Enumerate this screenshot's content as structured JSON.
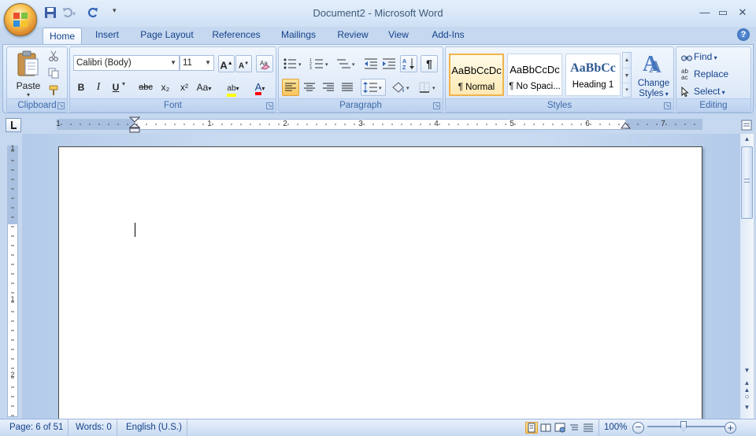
{
  "window": {
    "title": "Document2 - Microsoft Word"
  },
  "tabs": [
    {
      "label": "Home"
    },
    {
      "label": "Insert"
    },
    {
      "label": "Page Layout"
    },
    {
      "label": "References"
    },
    {
      "label": "Mailings"
    },
    {
      "label": "Review"
    },
    {
      "label": "View"
    },
    {
      "label": "Add-Ins"
    }
  ],
  "clipboard": {
    "paste_label": "Paste",
    "group_label": "Clipboard"
  },
  "font": {
    "name": "Calibri (Body)",
    "size": "11",
    "group_label": "Font",
    "bold": "B",
    "italic": "I",
    "underline": "U",
    "strike": "abc",
    "subscript": "x₂",
    "superscript": "x²",
    "change_case": "Aa",
    "grow": "A",
    "shrink": "A",
    "highlight_letters": "ab",
    "font_color_letter": "A"
  },
  "paragraph": {
    "group_label": "Paragraph",
    "pilcrow": "¶"
  },
  "styles": {
    "group_label": "Styles",
    "items": [
      {
        "sample": "AaBbCcDc",
        "name": "¶ Normal"
      },
      {
        "sample": "AaBbCcDc",
        "name": "¶ No Spaci..."
      },
      {
        "sample": "AaBbCc",
        "name": "Heading 1"
      }
    ],
    "change_styles_line1": "Change",
    "change_styles_line2": "Styles"
  },
  "editing": {
    "group_label": "Editing",
    "find": "Find",
    "replace": "Replace",
    "select": "Select"
  },
  "ruler": {
    "h_numbers": [
      "1",
      "1",
      "2",
      "3",
      "4",
      "5",
      "6",
      "7"
    ],
    "v_numbers": [
      "1",
      "1",
      "2"
    ]
  },
  "status": {
    "page": "Page: 6 of 51",
    "words": "Words: 0",
    "language": "English (U.S.)",
    "zoom": "100%"
  },
  "colors": {
    "accent": "#15428b",
    "highlight": "#ffff00",
    "font_color": "#ff0000"
  }
}
